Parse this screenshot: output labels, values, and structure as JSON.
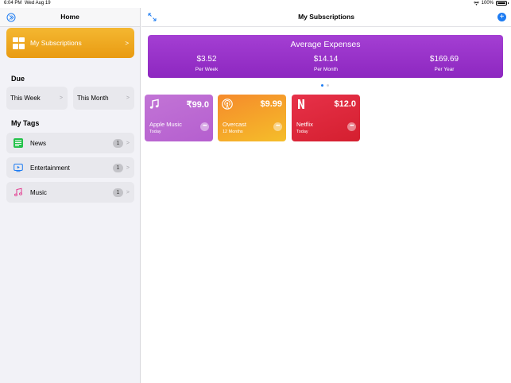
{
  "status_bar": {
    "time": "6:04 PM",
    "date": "Wed Aug 19",
    "battery": "100%"
  },
  "sidebar": {
    "title": "Home",
    "my_subscriptions": {
      "label": "My Subscriptions",
      "chevron": ">"
    },
    "due_title": "Due",
    "due_items": [
      {
        "label": "This Week",
        "chevron": ">"
      },
      {
        "label": "This Month",
        "chevron": ">"
      }
    ],
    "tags_title": "My Tags",
    "tags": [
      {
        "label": "News",
        "count": "1",
        "chevron": ">",
        "icon": "news-icon"
      },
      {
        "label": "Entertainment",
        "count": "1",
        "chevron": ">",
        "icon": "tv-icon"
      },
      {
        "label": "Music",
        "count": "1",
        "chevron": ">",
        "icon": "music-note-icon"
      }
    ]
  },
  "main": {
    "title": "My Subscriptions",
    "add_icon": "+",
    "expenses": {
      "title": "Average Expenses",
      "columns": [
        {
          "value": "$3.52",
          "label": "Per Week"
        },
        {
          "value": "$14.14",
          "label": "Per Month"
        },
        {
          "value": "$169.69",
          "label": "Per Year"
        }
      ]
    },
    "page_indicator": {
      "count": 2,
      "active": 0
    },
    "cards": [
      {
        "name": "Apple Music",
        "sub": "Today",
        "price": "₹99.0",
        "icon": "music-note-icon",
        "color_top": "#c274d6",
        "color_bottom": "#b55fcf"
      },
      {
        "name": "Overcast",
        "sub": "12 Months",
        "price": "$9.99",
        "icon": "podcast-icon",
        "color_top": "#f58a2b",
        "color_bottom": "#f5be2a"
      },
      {
        "name": "Netflix",
        "sub": "Today",
        "price": "$12.0",
        "icon": "netflix-logo-icon",
        "color_top": "#e73149",
        "color_bottom": "#d41f2f"
      }
    ]
  },
  "colors": {
    "accent": "#1e7cf2",
    "expenses_bg": "#9b33cc",
    "subs_bg": "#f0aa20"
  }
}
